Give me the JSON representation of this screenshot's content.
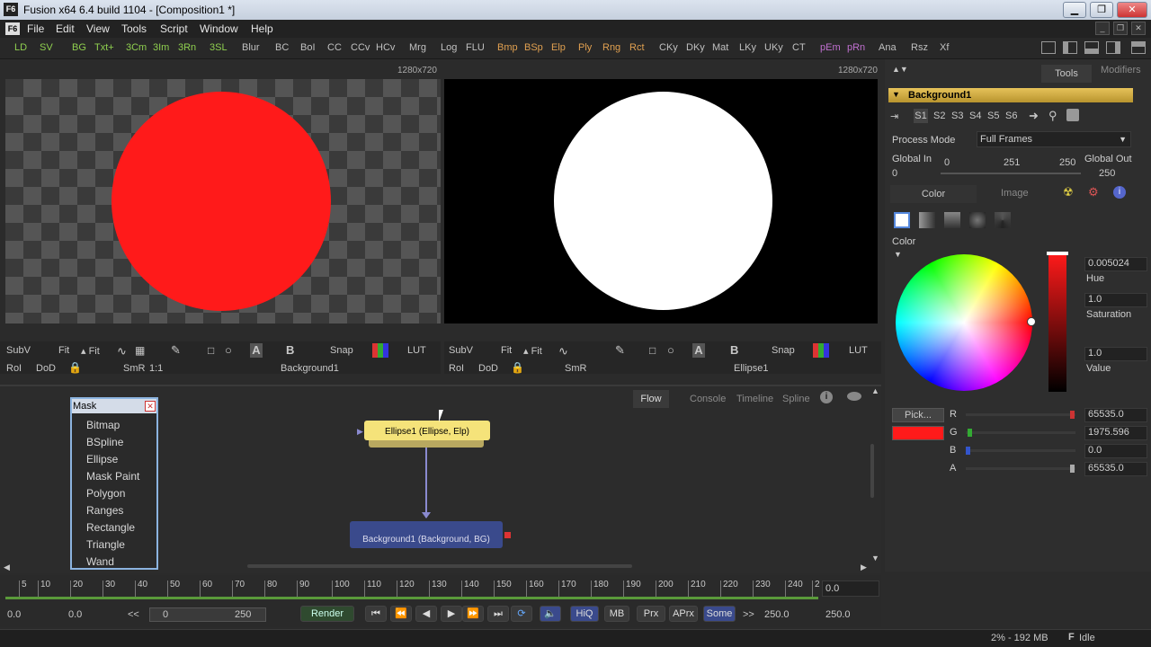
{
  "window": {
    "title": "Fusion x64 6.4 build 1104 - [Composition1 *]",
    "logo": "F6"
  },
  "menu": [
    "File",
    "Edit",
    "View",
    "Tools",
    "Script",
    "Window",
    "Help"
  ],
  "toolbar": [
    "LD",
    "SV",
    "BG",
    "Txt+",
    "3Cm",
    "3Im",
    "3Rn",
    "3SL",
    "Blur",
    "BC",
    "BoI",
    "CC",
    "CCv",
    "HCv",
    "Mrg",
    "Log",
    "FLU",
    "Bmp",
    "BSp",
    "Elp",
    "Ply",
    "Rng",
    "Rct",
    "CKy",
    "DKy",
    "Mat",
    "LKy",
    "UKy",
    "CT",
    "pEm",
    "pRn",
    "Ana",
    "Rsz",
    "Xf"
  ],
  "viewers": {
    "left": {
      "resolution": "1280x720",
      "tool": "Background1",
      "circle_color": "#ff1a1a"
    },
    "right": {
      "resolution": "1280x720",
      "tool": "Ellipse1",
      "circle_color": "#ffffff"
    },
    "ctrl": {
      "subv": "SubV",
      "fit1": "Fit",
      "fit2": "Fit",
      "snap": "Snap",
      "lut": "LUT",
      "roi": "RoI",
      "dod": "DoD",
      "smr": "SmR",
      "one": "1:1",
      "a": "A",
      "b": "B"
    }
  },
  "flow": {
    "tabs": [
      "Flow",
      "Console",
      "Timeline",
      "Spline"
    ],
    "mask_panel": {
      "title": "Mask",
      "items": [
        "Bitmap",
        "BSpline",
        "Ellipse",
        "Mask Paint",
        "Polygon",
        "Ranges",
        "Rectangle",
        "Triangle",
        "Wand"
      ]
    },
    "node_ellipse": "Ellipse1  (Ellipse, Elp)",
    "node_background": "Background1  (Background, BG)"
  },
  "tools_panel": {
    "tabs": [
      "Tools",
      "Modifiers"
    ],
    "tool_name": "Background1",
    "versions": [
      "S1",
      "S2",
      "S3",
      "S4",
      "S5",
      "S6"
    ],
    "process_mode_label": "Process Mode",
    "process_mode_value": "Full Frames",
    "global_in_label": "Global In",
    "global_out_label": "Global Out",
    "global_in": "0",
    "global_out": "250",
    "range_ticks": [
      "0",
      "251",
      "250"
    ],
    "subtabs": [
      "Color",
      "Image"
    ],
    "color_label": "Color",
    "hue": "0.005024",
    "hue_label": "Hue",
    "saturation": "1.0",
    "saturation_label": "Saturation",
    "value": "1.0",
    "value_label": "Value",
    "pick_label": "Pick...",
    "swatch_color": "#ff1a1a",
    "channels": [
      {
        "name": "R",
        "value": "65535.0"
      },
      {
        "name": "G",
        "value": "1975.596"
      },
      {
        "name": "B",
        "value": "0.0"
      },
      {
        "name": "A",
        "value": "65535.0"
      }
    ]
  },
  "timeline": {
    "ticks": [
      "5",
      "10",
      "20",
      "30",
      "40",
      "50",
      "60",
      "70",
      "80",
      "90",
      "100",
      "110",
      "120",
      "130",
      "140",
      "150",
      "160",
      "170",
      "180",
      "190",
      "200",
      "210",
      "220",
      "230",
      "240",
      "2"
    ],
    "current": "0.0"
  },
  "transport": {
    "start": "0.0",
    "render_start": "0.0",
    "range_in": "0",
    "range_out": "250",
    "render_label": "Render",
    "hiq": "HiQ",
    "mb": "MB",
    "prx": "Prx",
    "aprx": "APrx",
    "some": "Some",
    "render_end": "250.0",
    "end": "250.0",
    "back": "<<",
    "fwd": ">>"
  },
  "status": {
    "memory": "2% - 192 MB",
    "state": "Idle",
    "state_icon": "F"
  }
}
